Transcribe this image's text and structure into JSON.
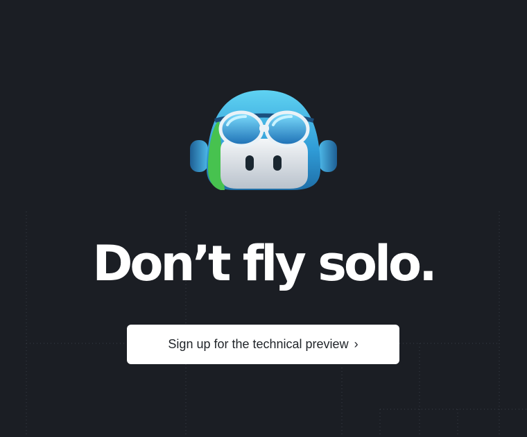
{
  "hero": {
    "headline": "Don’t fly solo.",
    "cta_label": "Sign up for the technical preview",
    "cta_chevron": "›"
  },
  "icons": {
    "mascot": "copilot-mascot-icon",
    "cta_chevron": "chevron-right-icon"
  },
  "colors": {
    "background": "#1b1e24",
    "headline": "#ffffff",
    "cta_background": "#ffffff",
    "cta_text": "#1f2328",
    "mascot_blue": "#3aa8e0",
    "mascot_green": "#4cc85a",
    "mascot_visor": "#1e6fb0"
  }
}
